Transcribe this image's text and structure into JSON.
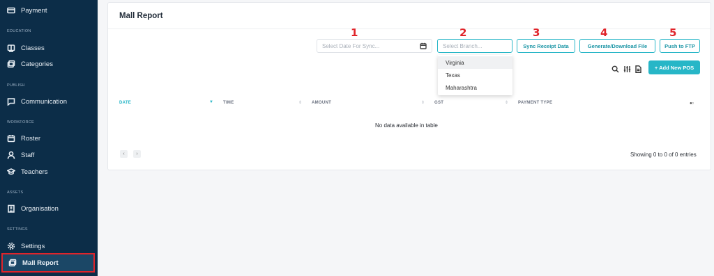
{
  "sidebar": {
    "items": [
      {
        "label": "Payment",
        "icon": "wallet-icon"
      },
      {
        "section": "EDUCATION"
      },
      {
        "label": "Classes",
        "icon": "book-icon"
      },
      {
        "label": "Categories",
        "icon": "layers-icon"
      },
      {
        "section": "PUBLISH"
      },
      {
        "label": "Communication",
        "icon": "chat-icon"
      },
      {
        "section": "WORKFORCE"
      },
      {
        "label": "Roster",
        "icon": "calendar-icon"
      },
      {
        "label": "Staff",
        "icon": "user-icon"
      },
      {
        "label": "Teachers",
        "icon": "graduation-cap-icon"
      },
      {
        "section": "ASSETS"
      },
      {
        "label": "Organisation",
        "icon": "building-icon"
      },
      {
        "section": "SETTINGS"
      },
      {
        "label": "Settings",
        "icon": "gear-icon"
      },
      {
        "label": "Mall Report",
        "icon": "report-icon",
        "active": true
      }
    ],
    "background": "#0c2d48",
    "highlight_color": "#e0242a"
  },
  "page": {
    "title": "Mall Report",
    "date_input": {
      "placeholder": "Select Date For Sync..."
    },
    "branch_input": {
      "placeholder": "Select Branch..."
    },
    "branch_options": [
      "Virginia",
      "Texas",
      "Maharashtra"
    ],
    "buttons": {
      "sync": "Sync Receipt Data",
      "generate": "Generate/Download File",
      "push": "Push to FTP",
      "add_pos": "+ Add New POS"
    },
    "annotations": [
      "1",
      "2",
      "3",
      "4",
      "5"
    ],
    "table": {
      "columns": [
        "DATE",
        "TIME",
        "AMOUNT",
        "GST",
        "PAYMENT TYPE"
      ],
      "empty_message": "No data available in table",
      "entries_info": "Showing 0 to 0 of 0 entries",
      "pager_prev": "‹",
      "pager_next": "›"
    },
    "accent_color": "#27b6c7",
    "annotation_color": "#e0242a"
  }
}
